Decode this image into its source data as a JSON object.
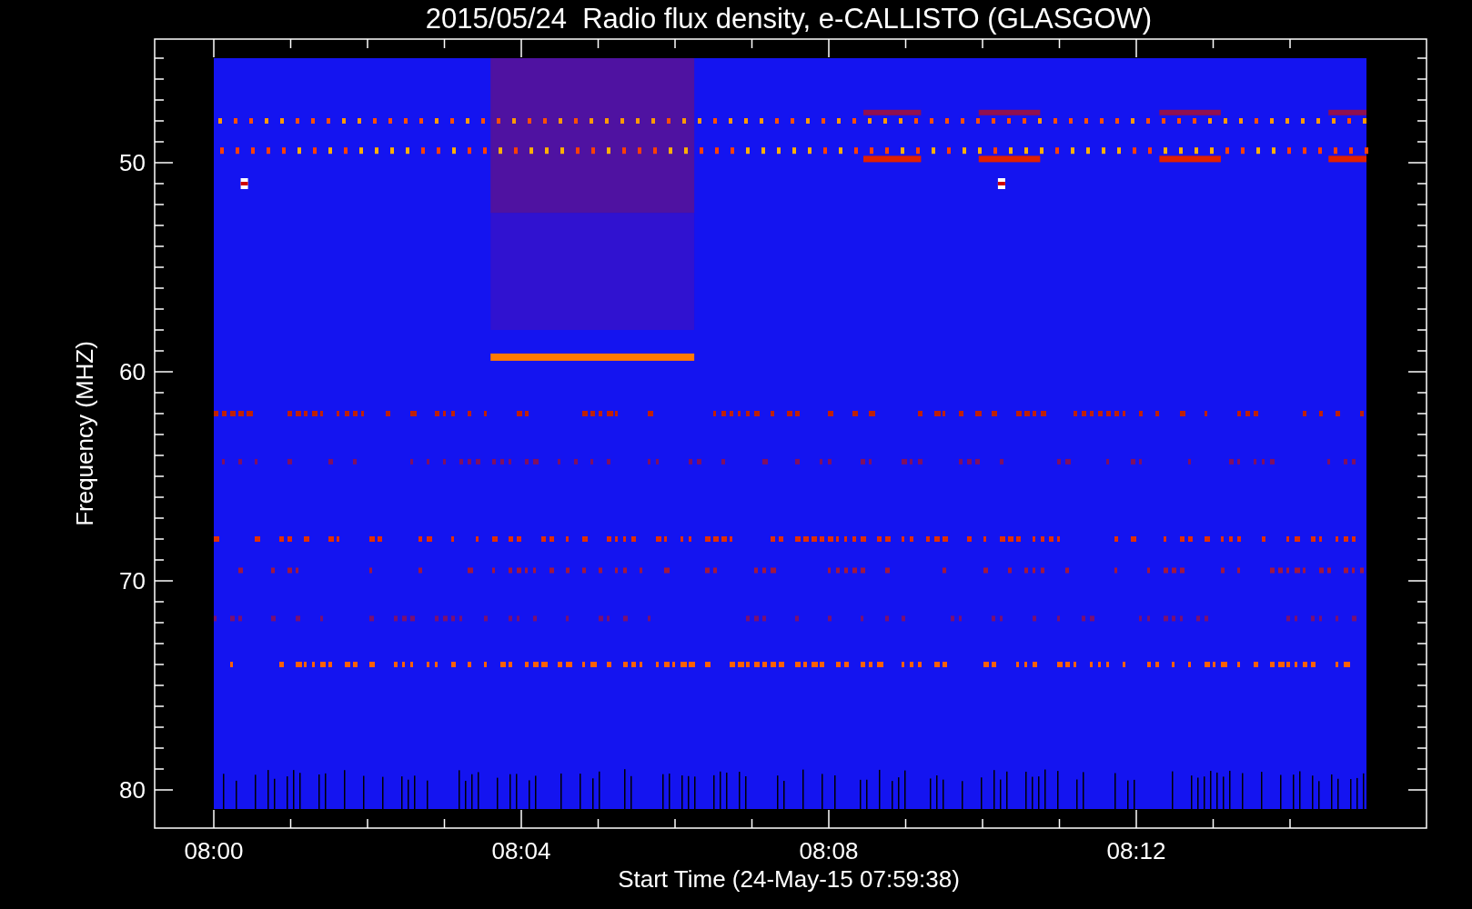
{
  "title": "2015/05/24  Radio flux density, e-CALLISTO (GLASGOW)",
  "x_axis": {
    "label": "Start Time (24-May-15 07:59:38)",
    "ticks": [
      "08:00",
      "08:04",
      "08:08",
      "08:12"
    ]
  },
  "y_axis": {
    "label": "Frequency (MHZ)",
    "ticks": [
      "50",
      "60",
      "70",
      "80"
    ]
  }
}
